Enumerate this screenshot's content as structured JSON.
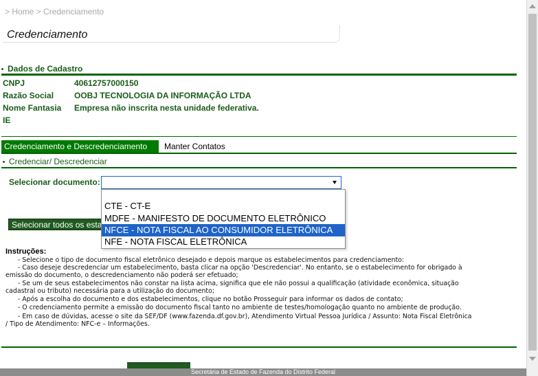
{
  "breadcrumb": "> Home > Credenciamento",
  "page_title": "Credenciamento",
  "sections": {
    "dados_cadastro": "Dados de Cadastro",
    "credenciar": "Credenciar/ Descredenciar"
  },
  "company": {
    "cnpj_label": "CNPJ",
    "cnpj": "40612757000150",
    "razao_label": "Razão Social",
    "razao": "OOBJ TECNOLOGIA DA INFORMAÇÃO LTDA",
    "fantasia_label": "Nome Fantasia",
    "fantasia": "Empresa não inscrita nesta unidade federativa.",
    "ie_label": "IE",
    "ie": ""
  },
  "tabs": {
    "cred": "Credenciamento e Descredenciamento",
    "contatos": "Manter Contatos"
  },
  "select": {
    "label": "Selecionar documento:",
    "value": "",
    "options": [
      "CTE - CT-E",
      "MDFE - MANIFESTO DE DOCUMENTO ELETRÔNICO",
      "NFCE - NOTA FISCAL AO CONSUMIDOR ELETRÔNICA",
      "NFE - NOTA FISCAL ELETRÔNICA"
    ],
    "highlighted_index": 2
  },
  "buttons": {
    "select_all": "Selecionar todos os esta"
  },
  "instructions": {
    "title": "Instruções:",
    "lines": [
      "      - Selecione o tipo de documento fiscal eletrônico desejado e depois marque os estabelecimentos para credenciamento:",
      "      - Caso deseje descredenciar um estabelecimento, basta clicar na opção 'Descredenciar'. No entanto, se o estabelecimento for obrigado à",
      "emissão do documento, o descredenciamento não poderá ser efetuado;",
      "      - Se um de seus estabelecimentos não constar na lista acima, significa que ele não possui a qualificação (atividade econômica, situação",
      "cadastral ou tributo) necessária para a utilização do documento;",
      "      - Após a escolha do documento e dos estabelecimentos, clique no botão Prosseguir para informar os dados de contato;",
      "      - O credenciamento permite a emissão do documento fiscal tanto no ambiente de testes/homologação quanto no ambiente de produção.",
      "      - Em caso de dúvidas, acesse o site da SEF/DF (www.fazenda.df.gov.br), Atendimento Virtual Pessoa Jurídica / Assunto: Nota Fiscal Eletrônica",
      "/ Tipo de Atendimento: NFC-e – Informações."
    ]
  },
  "footer": "Secretária de Estado de Fazenda do Distrito Federal",
  "colors": {
    "brand_green": "#1a5c1a",
    "tab_active": "#007a00",
    "highlight": "#1e64c8",
    "footer_bg": "#8c8c8c"
  }
}
